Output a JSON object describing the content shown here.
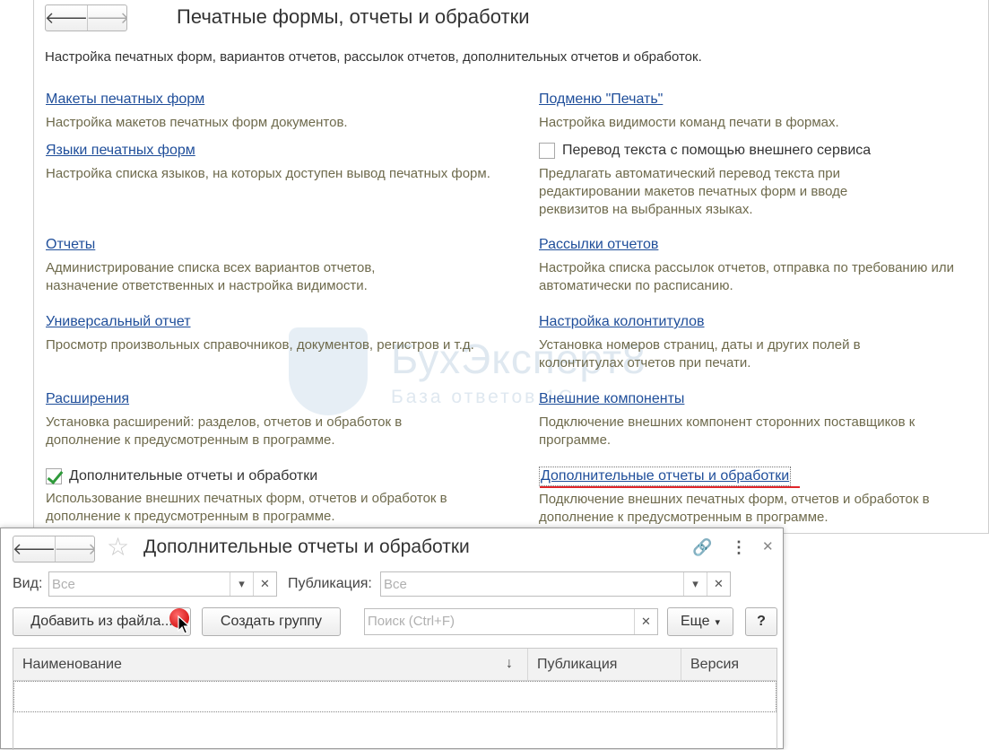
{
  "window1": {
    "title": "Печатные формы, отчеты и обработки",
    "subtitle": "Настройка печатных форм, вариантов отчетов, рассылок отчетов, дополнительных отчетов и обработок.",
    "nav": {
      "back": "🡐",
      "forward": "🡒"
    },
    "left": [
      {
        "link": "Макеты печатных форм",
        "desc": "Настройка макетов печатных форм документов."
      },
      {
        "link": "Языки печатных форм",
        "desc": "Настройка списка языков, на которых доступен вывод печатных форм."
      },
      {
        "link": "Отчеты",
        "desc": "Администрирование списка всех вариантов отчетов, назначение ответственных и настройка видимости."
      },
      {
        "link": "Универсальный отчет",
        "desc": "Просмотр произвольных справочников, документов, регистров и т.д."
      },
      {
        "link": "Расширения",
        "desc": "Установка расширений: разделов, отчетов и обработок в дополнение к предусмотренным в программе."
      },
      {
        "checkbox": "Дополнительные отчеты и обработки",
        "checked": true,
        "desc": "Использование внешних печатных форм, отчетов и обработок в дополнение к предусмотренным в программе."
      }
    ],
    "right": [
      {
        "link": "Подменю \"Печать\"",
        "desc": "Настройка видимости команд печати в формах."
      },
      {
        "checkbox": "Перевод текста с помощью внешнего сервиса",
        "checked": false,
        "desc": "Предлагать автоматический перевод текста при редактировании макетов печатных форм и вводе реквизитов на выбранных языках."
      },
      {
        "link": "Рассылки отчетов",
        "desc": "Настройка списка рассылок отчетов, отправка по требованию или автоматически по расписанию."
      },
      {
        "link": "Настройка колонтитулов",
        "desc": "Установка номеров страниц, даты и других полей в колонтитулах отчетов при печати."
      },
      {
        "link": "Внешние компоненты",
        "desc": "Подключение внешних компонент сторонних поставщиков к программе."
      },
      {
        "link": "Дополнительные отчеты и обработки",
        "desc": "Подключение внешних печатных форм, отчетов и обработок в дополнение к предусмотренным в программе."
      }
    ],
    "watermark": {
      "line1": "БухЭксперт8",
      "line2": "База ответов 1С"
    }
  },
  "window2": {
    "title": "Дополнительные отчеты и обработки",
    "icons": {
      "link": "🔗",
      "menu": "⋮",
      "close": "✕"
    },
    "filters": {
      "vid_label": "Вид:",
      "vid_placeholder": "Все",
      "pub_label": "Публикация:",
      "pub_placeholder": "Все",
      "dropdown_glyph": "▾",
      "clear_glyph": "✕"
    },
    "toolbar": {
      "add_from_file": "Добавить из файла...",
      "create_group": "Создать группу",
      "search_placeholder": "Поиск (Ctrl+F)",
      "more": "Еще",
      "more_glyph": "▾",
      "help": "?"
    },
    "table": {
      "columns": [
        "Наименование",
        "Публикация",
        "Версия"
      ],
      "sort_glyph": "↓"
    }
  }
}
